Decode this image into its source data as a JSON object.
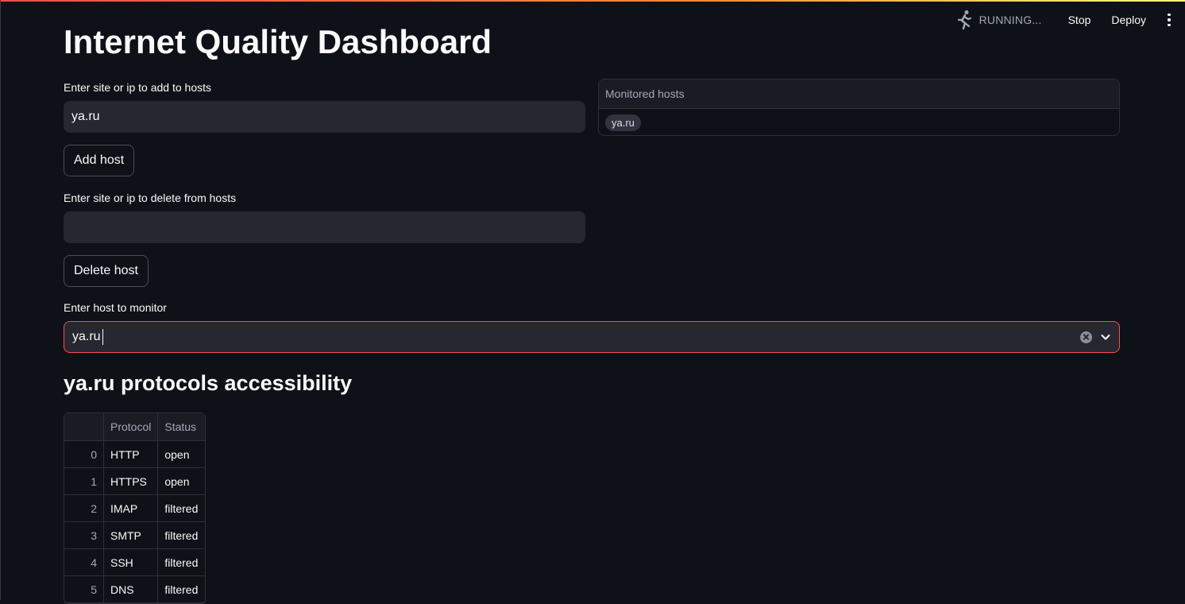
{
  "toolbar": {
    "status": "RUNNING...",
    "stop_label": "Stop",
    "deploy_label": "Deploy"
  },
  "page_title": "Internet Quality Dashboard",
  "add_host": {
    "label": "Enter site or ip to add to hosts",
    "value": "ya.ru",
    "button": "Add host"
  },
  "delete_host": {
    "label": "Enter site or ip to delete from hosts",
    "value": "",
    "button": "Delete host"
  },
  "monitored_hosts": {
    "header": "Monitored hosts",
    "items": [
      "ya.ru"
    ]
  },
  "monitor_select": {
    "label": "Enter host to monitor",
    "value": "ya.ru"
  },
  "protocols_section": {
    "title": "ya.ru protocols accessibility",
    "columns": [
      "",
      "Protocol",
      "Status"
    ],
    "rows": [
      [
        "0",
        "HTTP",
        "open"
      ],
      [
        "1",
        "HTTPS",
        "open"
      ],
      [
        "2",
        "IMAP",
        "filtered"
      ],
      [
        "3",
        "SMTP",
        "filtered"
      ],
      [
        "4",
        "SSH",
        "filtered"
      ],
      [
        "5",
        "DNS",
        "filtered"
      ]
    ]
  },
  "colors": {
    "background": "#0e1117",
    "input": "#262730",
    "accent": "#ff4b4b"
  }
}
